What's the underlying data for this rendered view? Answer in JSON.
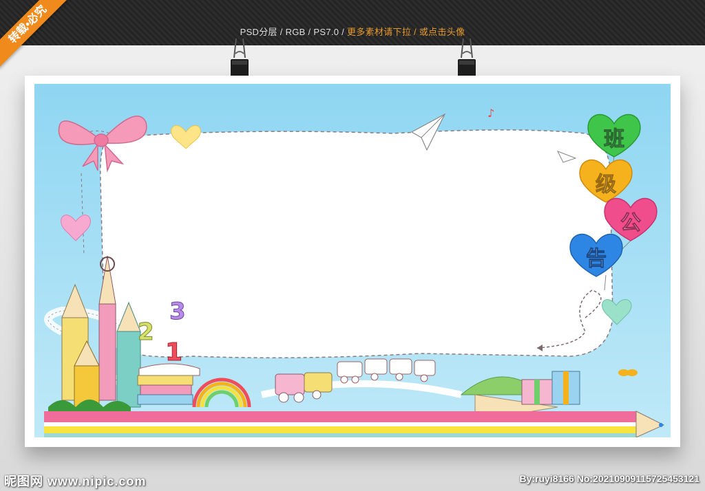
{
  "watermark": {
    "header_text_main": "PSD分层 / RGB / PS7.0 / ",
    "header_text_highlight": "更多素材请下拉 / 或点击头像",
    "corner_ribbon": "转载•必究",
    "footer_site": "昵图网 www.nipic.com",
    "footer_id": "By:ruyi8166 No:20210909115725453121"
  },
  "poster": {
    "title_chars": [
      "班",
      "级",
      "公",
      "告"
    ],
    "numbers": [
      "1",
      "2",
      "3"
    ],
    "balloon_colors": [
      "#3fc64a",
      "#f5b21c",
      "#ef4d8c",
      "#2d86e4"
    ],
    "pencil_stripe_colors": [
      "#f06c9a",
      "#ffffff",
      "#f8e43c",
      "#9ed8d4"
    ]
  }
}
